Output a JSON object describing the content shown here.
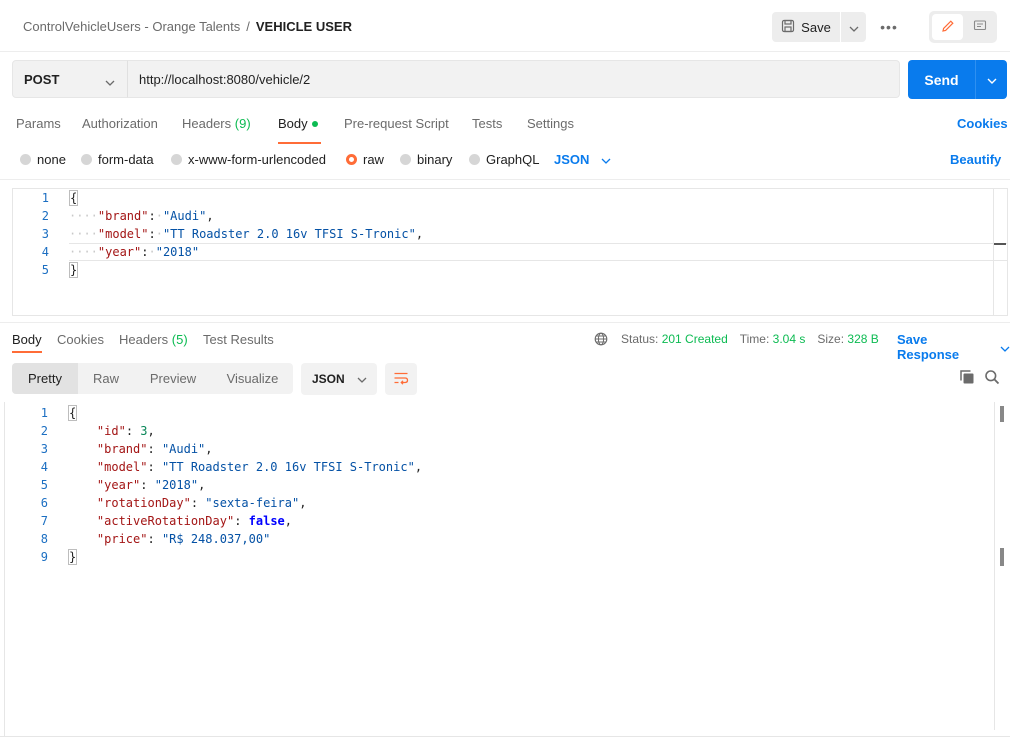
{
  "header": {
    "breadcrumb_parent": "ControlVehicleUsers - Orange Talents",
    "breadcrumb_separator": "/",
    "breadcrumb_current": "VEHICLE USER",
    "save_label": "Save",
    "more_label": "•••"
  },
  "request": {
    "method": "POST",
    "url": "http://localhost:8080/vehicle/2",
    "send_label": "Send"
  },
  "request_tabs": {
    "params": "Params",
    "authorization": "Authorization",
    "headers": "Headers",
    "headers_count": "(9)",
    "body": "Body",
    "pre_request": "Pre-request Script",
    "tests": "Tests",
    "settings": "Settings",
    "cookies": "Cookies"
  },
  "body_types": {
    "none": "none",
    "form_data": "form-data",
    "urlencoded": "x-www-form-urlencoded",
    "raw": "raw",
    "binary": "binary",
    "graphql": "GraphQL",
    "language": "JSON",
    "beautify": "Beautify",
    "selected": "raw"
  },
  "request_body": {
    "line_numbers": [
      "1",
      "2",
      "3",
      "4",
      "5"
    ],
    "open_brace": "{",
    "close_brace": "}",
    "fields": [
      {
        "key": "\"brand\"",
        "value": "\"Audi\"",
        "trail": ","
      },
      {
        "key": "\"model\"",
        "value": "\"TT Roadster 2.0 16v TFSI S-Tronic\"",
        "trail": ","
      },
      {
        "key": "\"year\"",
        "value": "\"2018\"",
        "trail": ""
      }
    ]
  },
  "response_tabs": {
    "body": "Body",
    "cookies": "Cookies",
    "headers": "Headers",
    "headers_count": "(5)",
    "test_results": "Test Results"
  },
  "response_status": {
    "status_label": "Status:",
    "status_value": "201 Created",
    "time_label": "Time:",
    "time_value": "3.04 s",
    "size_label": "Size:",
    "size_value": "328 B",
    "save_response": "Save Response"
  },
  "response_view": {
    "pretty": "Pretty",
    "raw": "Raw",
    "preview": "Preview",
    "visualize": "Visualize",
    "format": "JSON"
  },
  "response_body": {
    "line_numbers": [
      "1",
      "2",
      "3",
      "4",
      "5",
      "6",
      "7",
      "8",
      "9"
    ],
    "open_brace": "{",
    "close_brace": "}",
    "fields": [
      {
        "key": "\"id\"",
        "value": "3",
        "type": "num",
        "trail": ","
      },
      {
        "key": "\"brand\"",
        "value": "\"Audi\"",
        "type": "str",
        "trail": ","
      },
      {
        "key": "\"model\"",
        "value": "\"TT Roadster 2.0 16v TFSI S-Tronic\"",
        "type": "str",
        "trail": ","
      },
      {
        "key": "\"year\"",
        "value": "\"2018\"",
        "type": "str",
        "trail": ","
      },
      {
        "key": "\"rotationDay\"",
        "value": "\"sexta-feira\"",
        "type": "str",
        "trail": ","
      },
      {
        "key": "\"activeRotationDay\"",
        "value": "false",
        "type": "bool",
        "trail": ","
      },
      {
        "key": "\"price\"",
        "value": "\"R$ 248.037,00\"",
        "type": "str",
        "trail": ""
      }
    ]
  },
  "colors": {
    "accent_orange": "#ff6c37",
    "link_blue": "#097bed",
    "status_green": "#0cbb52"
  },
  "icons": [
    "save-icon",
    "chevron-down-icon",
    "more-icon",
    "pencil-icon",
    "comment-icon",
    "globe-icon",
    "wrap-lines-icon",
    "copy-icon",
    "search-icon"
  ]
}
